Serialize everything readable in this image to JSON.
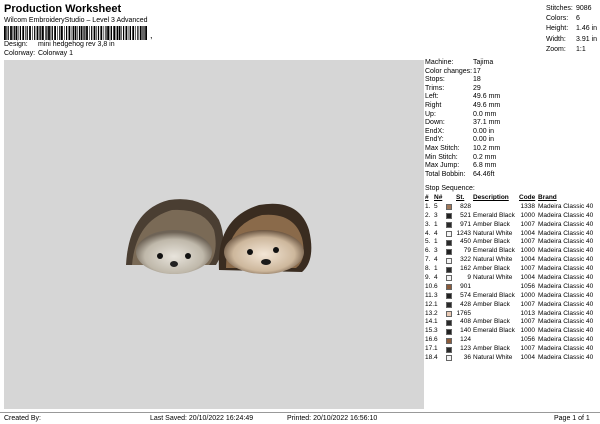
{
  "header": {
    "title": "Production Worksheet",
    "subtitle": "Wilcom EmbroideryStudio – Level 3 Advanced",
    "barcode_suffix": ",",
    "design_label": "Design:",
    "design_value": "mini hedgehog rev 3,8 in",
    "colorway_label": "Colorway:",
    "colorway_value": "Colorway 1"
  },
  "summary": [
    {
      "label": "Stitches:",
      "value": "9086"
    },
    {
      "label": "Colors:",
      "value": "6"
    },
    {
      "label": "Height:",
      "value": "1.46 in"
    },
    {
      "label": "Width:",
      "value": "3.91 in"
    },
    {
      "label": "Zoom:",
      "value": "1:1"
    }
  ],
  "properties": [
    {
      "label": "Machine:",
      "value": "Tajima"
    },
    {
      "label": "Color changes:",
      "value": "17"
    },
    {
      "label": "Stops:",
      "value": "18"
    },
    {
      "label": "Trims:",
      "value": "29"
    },
    {
      "label": "Left:",
      "value": "49.6 mm"
    },
    {
      "label": "Right",
      "value": "49.6 mm"
    },
    {
      "label": "Up:",
      "value": "0.0 mm"
    },
    {
      "label": "Down:",
      "value": "37.1 mm"
    },
    {
      "label": "EndX:",
      "value": "0.00 in"
    },
    {
      "label": "EndY:",
      "value": "0.00 in"
    },
    {
      "label": "Max Stitch:",
      "value": "10.2 mm"
    },
    {
      "label": "Min Stitch:",
      "value": "0.2 mm"
    },
    {
      "label": "Max Jump:",
      "value": "6.8 mm"
    },
    {
      "label": "Total Bobbin:",
      "value": "64.46ft"
    }
  ],
  "sequence": {
    "title": "Stop Sequence:",
    "headers": {
      "num": "#",
      "n": "N#",
      "st": "St.",
      "desc": "Description",
      "code": "Code",
      "brand": "Brand"
    },
    "rows": [
      {
        "num": "1.",
        "n": "5",
        "color": "#a0785a",
        "st": "828",
        "desc": "",
        "code": "1338",
        "brand": "Madeira Classic 40"
      },
      {
        "num": "2.",
        "n": "3",
        "color": "#222222",
        "st": "521",
        "desc": "Emerald Black",
        "code": "1000",
        "brand": "Madeira Classic 40"
      },
      {
        "num": "3.",
        "n": "1",
        "color": "#2a2a2a",
        "st": "971",
        "desc": "Amber Black",
        "code": "1007",
        "brand": "Madeira Classic 40"
      },
      {
        "num": "4.",
        "n": "4",
        "color": "#f4f4f4",
        "st": "1243",
        "desc": "Natural White",
        "code": "1004",
        "brand": "Madeira Classic 40"
      },
      {
        "num": "5.",
        "n": "1",
        "color": "#2a2a2a",
        "st": "450",
        "desc": "Amber Black",
        "code": "1007",
        "brand": "Madeira Classic 40"
      },
      {
        "num": "6.",
        "n": "3",
        "color": "#222222",
        "st": "79",
        "desc": "Emerald Black",
        "code": "1000",
        "brand": "Madeira Classic 40"
      },
      {
        "num": "7.",
        "n": "4",
        "color": "#f4f4f4",
        "st": "322",
        "desc": "Natural White",
        "code": "1004",
        "brand": "Madeira Classic 40"
      },
      {
        "num": "8.",
        "n": "1",
        "color": "#2a2a2a",
        "st": "162",
        "desc": "Amber Black",
        "code": "1007",
        "brand": "Madeira Classic 40"
      },
      {
        "num": "9.",
        "n": "4",
        "color": "#f4f4f4",
        "st": "9",
        "desc": "Natural White",
        "code": "1004",
        "brand": "Madeira Classic 40"
      },
      {
        "num": "10.",
        "n": "6",
        "color": "#8a5a3a",
        "st": "901",
        "desc": "",
        "code": "1056",
        "brand": "Madeira Classic 40"
      },
      {
        "num": "11.",
        "n": "3",
        "color": "#222222",
        "st": "574",
        "desc": "Emerald Black",
        "code": "1000",
        "brand": "Madeira Classic 40"
      },
      {
        "num": "12.",
        "n": "1",
        "color": "#2a2a2a",
        "st": "428",
        "desc": "Amber Black",
        "code": "1007",
        "brand": "Madeira Classic 40"
      },
      {
        "num": "13.",
        "n": "2",
        "color": "#e8c9b4",
        "st": "1765",
        "desc": "",
        "code": "1013",
        "brand": "Madeira Classic 40"
      },
      {
        "num": "14.",
        "n": "1",
        "color": "#2a2a2a",
        "st": "408",
        "desc": "Amber Black",
        "code": "1007",
        "brand": "Madeira Classic 40"
      },
      {
        "num": "15.",
        "n": "3",
        "color": "#222222",
        "st": "140",
        "desc": "Emerald Black",
        "code": "1000",
        "brand": "Madeira Classic 40"
      },
      {
        "num": "16.",
        "n": "6",
        "color": "#8a5a3a",
        "st": "124",
        "desc": "",
        "code": "1056",
        "brand": "Madeira Classic 40"
      },
      {
        "num": "17.",
        "n": "1",
        "color": "#2a2a2a",
        "st": "123",
        "desc": "Amber Black",
        "code": "1007",
        "brand": "Madeira Classic 40"
      },
      {
        "num": "18.",
        "n": "4",
        "color": "#f4f4f4",
        "st": "36",
        "desc": "Natural White",
        "code": "1004",
        "brand": "Madeira Classic 40"
      }
    ]
  },
  "footer": {
    "created_by": "Created By:",
    "last_saved": "Last Saved: 20/10/2022 16:24:49",
    "printed": "Printed: 20/10/2022 16:56:10",
    "page": "Page 1 of 1"
  }
}
